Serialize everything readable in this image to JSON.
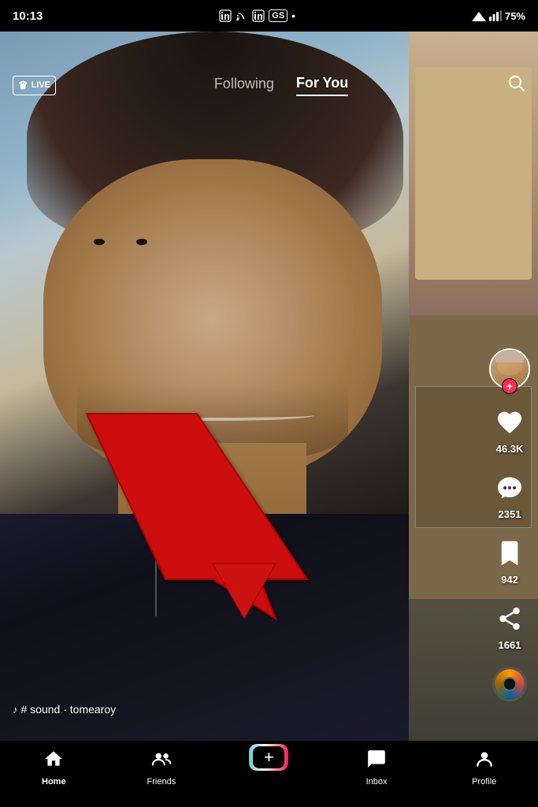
{
  "statusBar": {
    "time": "10:13",
    "battery": "75%",
    "batteryIcon": "battery-icon",
    "signalIcon": "signal-icon"
  },
  "topNav": {
    "liveLabel": "LIVE",
    "tabs": [
      {
        "id": "following",
        "label": "Following",
        "active": false
      },
      {
        "id": "forYou",
        "label": "For You",
        "active": true
      }
    ],
    "searchLabel": "search"
  },
  "video": {
    "soundLabel": "♪ # sound · tomearoy",
    "actions": {
      "likeCount": "46.3K",
      "commentCount": "2351",
      "bookmarkCount": "942",
      "shareCount": "1661"
    }
  },
  "bottomNav": {
    "items": [
      {
        "id": "home",
        "label": "Home",
        "active": true
      },
      {
        "id": "friends",
        "label": "Friends",
        "active": false
      },
      {
        "id": "create",
        "label": "",
        "active": false
      },
      {
        "id": "inbox",
        "label": "Inbox",
        "active": false
      },
      {
        "id": "profile",
        "label": "Profile",
        "active": false
      }
    ]
  }
}
